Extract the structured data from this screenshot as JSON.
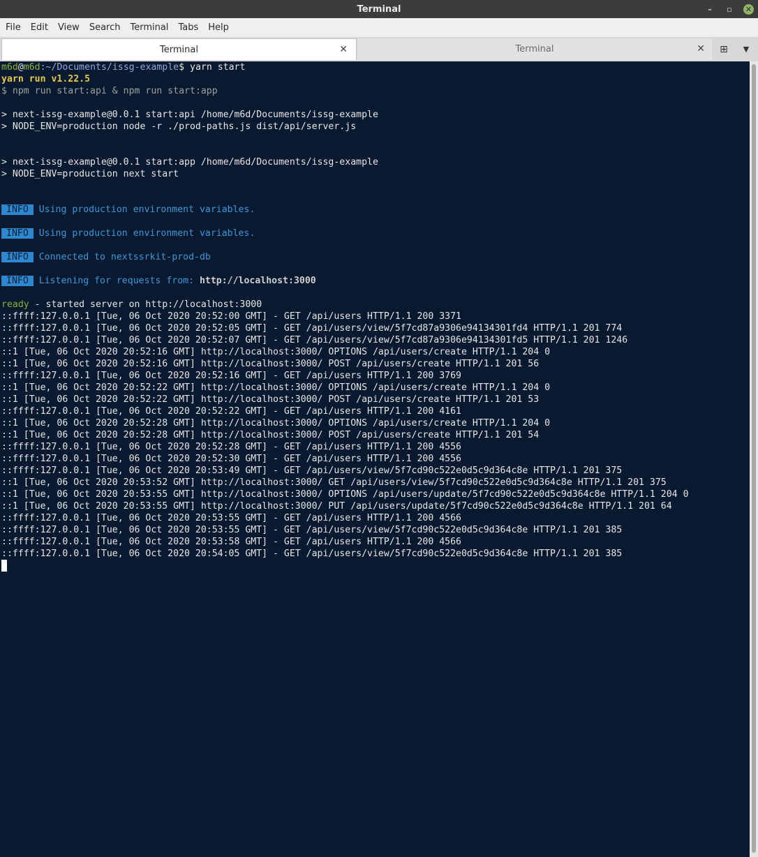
{
  "window": {
    "title": "Terminal",
    "controls": {
      "minimize": "–",
      "restore": "▫",
      "close": "✕"
    }
  },
  "menu": [
    "File",
    "Edit",
    "View",
    "Search",
    "Terminal",
    "Tabs",
    "Help"
  ],
  "tabs": [
    {
      "label": "Terminal",
      "active": true,
      "close": "✕"
    },
    {
      "label": "Terminal",
      "active": false,
      "close": "✕"
    }
  ],
  "tab_actions": {
    "new_tab": "⊞",
    "menu": "▼"
  },
  "prompt": {
    "user": "m6d",
    "at": "@",
    "host": "m6d",
    "path": ":~/Documents/issg-example",
    "symbol": "$",
    "command": " yarn start"
  },
  "output": {
    "yarn_version": "yarn run v1.22.5",
    "npm_cmd": "$ npm run start:api & npm run start:app",
    "api_script": "> next-issg-example@0.0.1 start:api /home/m6d/Documents/issg-example",
    "api_env": "> NODE_ENV=production node -r ./prod-paths.js dist/api/server.js",
    "app_script": "> next-issg-example@0.0.1 start:app /home/m6d/Documents/issg-example",
    "app_env": "> NODE_ENV=production next start",
    "info": [
      {
        "badge": "INFO",
        "text": "Using production environment variables.",
        "bold": ""
      },
      {
        "badge": "INFO",
        "text": "Using production environment variables.",
        "bold": ""
      },
      {
        "badge": "INFO",
        "text": "Connected to nextssrkit-prod-db",
        "bold": ""
      },
      {
        "badge": "INFO",
        "text": "Listening for requests from: ",
        "bold": "http://localhost:3000"
      }
    ],
    "ready_word": "ready",
    "ready_text": " - started server on http://localhost:3000",
    "logs": [
      "::ffff:127.0.0.1 [Tue, 06 Oct 2020 20:52:00 GMT] - GET /api/users HTTP/1.1 200 3371",
      "::ffff:127.0.0.1 [Tue, 06 Oct 2020 20:52:05 GMT] - GET /api/users/view/5f7cd87a9306e94134301fd4 HTTP/1.1 201 774",
      "::ffff:127.0.0.1 [Tue, 06 Oct 2020 20:52:07 GMT] - GET /api/users/view/5f7cd87a9306e94134301fd5 HTTP/1.1 201 1246",
      "::1 [Tue, 06 Oct 2020 20:52:16 GMT] http://localhost:3000/ OPTIONS /api/users/create HTTP/1.1 204 0",
      "::1 [Tue, 06 Oct 2020 20:52:16 GMT] http://localhost:3000/ POST /api/users/create HTTP/1.1 201 56",
      "::ffff:127.0.0.1 [Tue, 06 Oct 2020 20:52:16 GMT] - GET /api/users HTTP/1.1 200 3769",
      "::1 [Tue, 06 Oct 2020 20:52:22 GMT] http://localhost:3000/ OPTIONS /api/users/create HTTP/1.1 204 0",
      "::1 [Tue, 06 Oct 2020 20:52:22 GMT] http://localhost:3000/ POST /api/users/create HTTP/1.1 201 53",
      "::ffff:127.0.0.1 [Tue, 06 Oct 2020 20:52:22 GMT] - GET /api/users HTTP/1.1 200 4161",
      "::1 [Tue, 06 Oct 2020 20:52:28 GMT] http://localhost:3000/ OPTIONS /api/users/create HTTP/1.1 204 0",
      "::1 [Tue, 06 Oct 2020 20:52:28 GMT] http://localhost:3000/ POST /api/users/create HTTP/1.1 201 54",
      "::ffff:127.0.0.1 [Tue, 06 Oct 2020 20:52:28 GMT] - GET /api/users HTTP/1.1 200 4556",
      "::ffff:127.0.0.1 [Tue, 06 Oct 2020 20:52:30 GMT] - GET /api/users HTTP/1.1 200 4556",
      "::ffff:127.0.0.1 [Tue, 06 Oct 2020 20:53:49 GMT] - GET /api/users/view/5f7cd90c522e0d5c9d364c8e HTTP/1.1 201 375",
      "::1 [Tue, 06 Oct 2020 20:53:52 GMT] http://localhost:3000/ GET /api/users/view/5f7cd90c522e0d5c9d364c8e HTTP/1.1 201 375",
      "::1 [Tue, 06 Oct 2020 20:53:55 GMT] http://localhost:3000/ OPTIONS /api/users/update/5f7cd90c522e0d5c9d364c8e HTTP/1.1 204 0",
      "::1 [Tue, 06 Oct 2020 20:53:55 GMT] http://localhost:3000/ PUT /api/users/update/5f7cd90c522e0d5c9d364c8e HTTP/1.1 201 64",
      "::ffff:127.0.0.1 [Tue, 06 Oct 2020 20:53:55 GMT] - GET /api/users HTTP/1.1 200 4566",
      "::ffff:127.0.0.1 [Tue, 06 Oct 2020 20:53:55 GMT] - GET /api/users/view/5f7cd90c522e0d5c9d364c8e HTTP/1.1 201 385",
      "::ffff:127.0.0.1 [Tue, 06 Oct 2020 20:53:58 GMT] - GET /api/users HTTP/1.1 200 4566",
      "::ffff:127.0.0.1 [Tue, 06 Oct 2020 20:54:05 GMT] - GET /api/users/view/5f7cd90c522e0d5c9d364c8e HTTP/1.1 201 385"
    ]
  },
  "colors": {
    "background": "#081930",
    "prompt_user": "#8ab43a",
    "prompt_path": "#8fa8d8",
    "yarn": "#e8c84a",
    "info_badge": "#2e88cf",
    "info_text": "#3d97d8",
    "ready": "#8ab43a"
  }
}
